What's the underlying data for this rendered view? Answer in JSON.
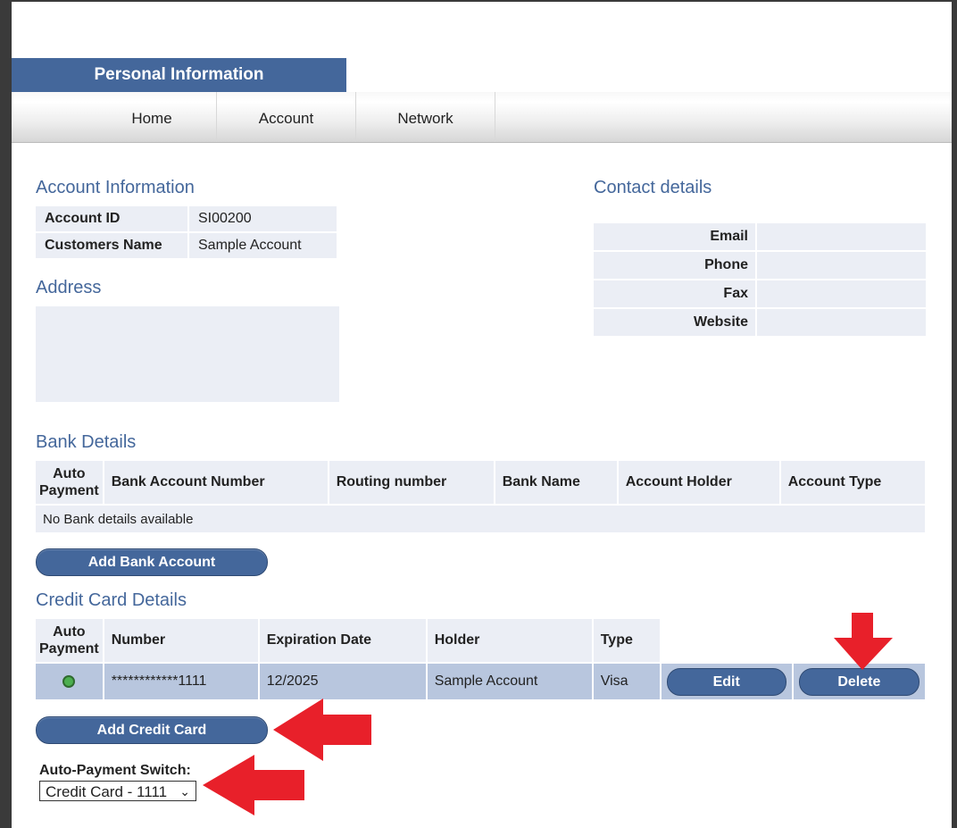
{
  "header": {
    "title": "Personal Information"
  },
  "nav": {
    "items": [
      "Home",
      "Account",
      "Network"
    ]
  },
  "account_info": {
    "title": "Account Information",
    "rows": [
      {
        "label": "Account ID",
        "value": "SI00200"
      },
      {
        "label": "Customers Name",
        "value": "Sample Account"
      }
    ]
  },
  "address": {
    "title": "Address"
  },
  "contact": {
    "title": "Contact details",
    "rows": [
      {
        "label": "Email",
        "value": ""
      },
      {
        "label": "Phone",
        "value": ""
      },
      {
        "label": "Fax",
        "value": ""
      },
      {
        "label": "Website",
        "value": ""
      }
    ]
  },
  "bank": {
    "title": "Bank Details",
    "columns": [
      "Auto Payment",
      "Bank Account Number",
      "Routing number",
      "Bank Name",
      "Account Holder",
      "Account Type"
    ],
    "empty_message": "No Bank details available",
    "add_button": "Add Bank Account"
  },
  "credit_card": {
    "title": "Credit Card Details",
    "columns": [
      "Auto Payment",
      "Number",
      "Expiration Date",
      "Holder",
      "Type"
    ],
    "rows": [
      {
        "auto_payment_status": "active",
        "number": "************1111",
        "expiration": "12/2025",
        "holder": "Sample Account",
        "type": "Visa",
        "edit_label": "Edit",
        "delete_label": "Delete"
      }
    ],
    "add_button": "Add Credit Card"
  },
  "auto_payment_switch": {
    "label": "Auto-Payment Switch:",
    "selected": "Credit Card - 1111"
  },
  "colors": {
    "accent": "#44679b",
    "row_highlight": "#b8c6de",
    "arrow": "#e8202a",
    "status_dot": "#4caf50"
  }
}
